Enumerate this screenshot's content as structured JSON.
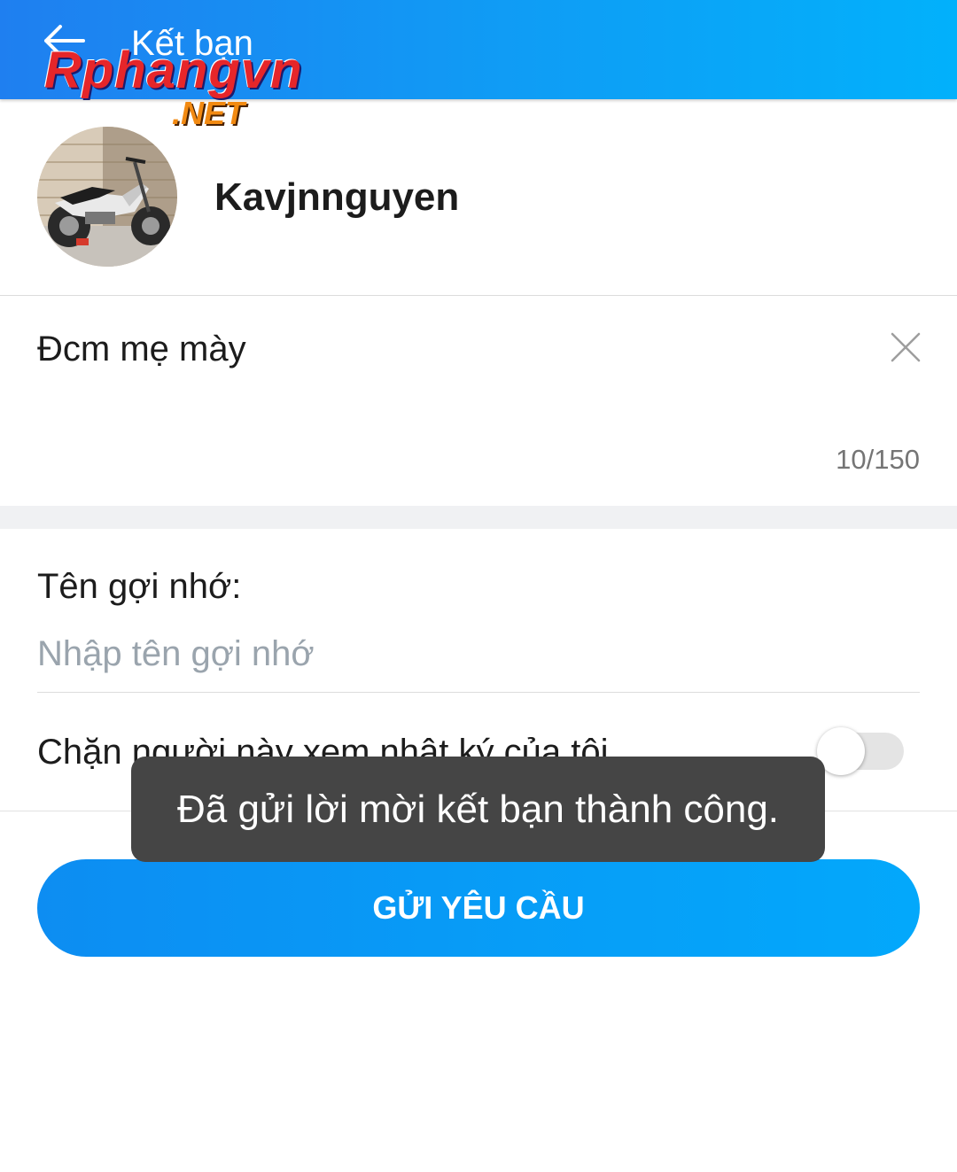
{
  "header": {
    "title": "Kết bạn",
    "back_icon": "arrow-left-icon",
    "background_colors": [
      "#1f7ff0",
      "#02b1fb"
    ]
  },
  "watermark": {
    "main": "Rphangvn",
    "suffix": ".NET"
  },
  "profile": {
    "name": "Kavjnnguyen",
    "avatar": "motorbike-photo"
  },
  "message": {
    "value": "Đcm mẹ mày",
    "counter": "10/150",
    "clear_icon": "close-icon"
  },
  "nickname": {
    "label": "Tên gợi nhớ:",
    "placeholder": "Nhập tên gợi nhớ",
    "value": ""
  },
  "block_diary": {
    "label": "Chặn người này xem nhật ký của tôi",
    "enabled": false
  },
  "send_button": {
    "label": "GỬI YÊU CẦU",
    "color": "#079df7"
  },
  "toast": {
    "text": "Đã gửi lời mời kết bạn thành công."
  }
}
